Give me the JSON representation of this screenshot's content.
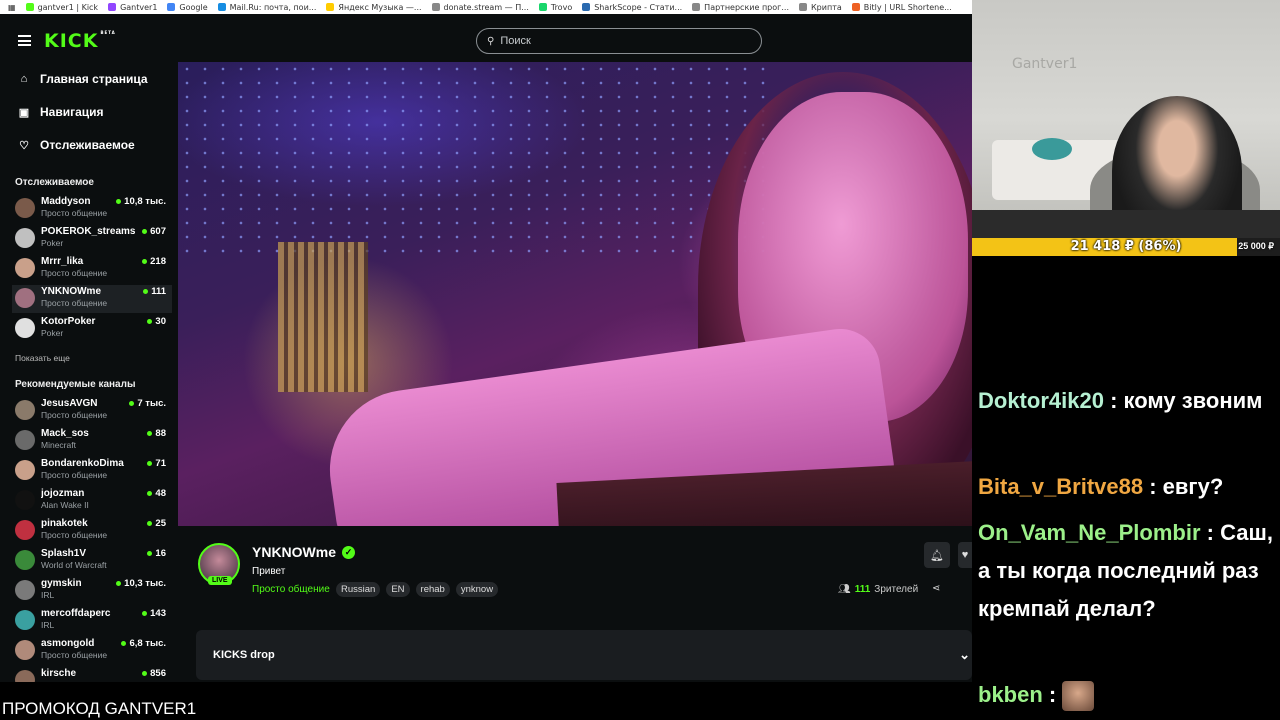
{
  "bookmarks": [
    {
      "label": "gantver1 | Kick",
      "color": "#53fc18"
    },
    {
      "label": "Gantver1",
      "color": "#9146ff"
    },
    {
      "label": "Google",
      "color": "#4285f4"
    },
    {
      "label": "Mail.Ru: почта, пои...",
      "color": "#168de2"
    },
    {
      "label": "Яндекс Музыка —...",
      "color": "#ffcc00"
    },
    {
      "label": "donate.stream — П...",
      "color": "#888888"
    },
    {
      "label": "Trovo",
      "color": "#19d66b"
    },
    {
      "label": "SharkScope - Стати...",
      "color": "#2a6ab0"
    },
    {
      "label": "Партнерские прог...",
      "color": "#888888"
    },
    {
      "label": "Крипта",
      "color": "#888888"
    },
    {
      "label": "Bitly | URL Shortene...",
      "color": "#ee6123"
    }
  ],
  "header": {
    "logo": "KICK",
    "logo_badge": "BETA",
    "search_placeholder": "Поиск"
  },
  "sidebar": {
    "nav": [
      {
        "label": "Главная страница",
        "icon": "home-icon"
      },
      {
        "label": "Навигация",
        "icon": "browse-icon"
      },
      {
        "label": "Отслеживаемое",
        "icon": "heart-icon"
      }
    ],
    "following_title": "Отслеживаемое",
    "following": [
      {
        "name": "Maddyson",
        "category": "Просто общение",
        "viewers": "10,8 тыс.",
        "color": "#7a5a4a"
      },
      {
        "name": "POKEROK_streams",
        "category": "Poker",
        "viewers": "607",
        "color": "#c0c0c0"
      },
      {
        "name": "Mrrr_lika",
        "category": "Просто общение",
        "viewers": "218",
        "color": "#c9a08a"
      },
      {
        "name": "YNKNOWme",
        "category": "Просто общение",
        "viewers": "111",
        "color": "#a07080"
      },
      {
        "name": "KotorPoker",
        "category": "Poker",
        "viewers": "30",
        "color": "#e0e0e0"
      }
    ],
    "show_more": "Показать еще",
    "recommended_title": "Рекомендуемые каналы",
    "recommended": [
      {
        "name": "JesusAVGN",
        "category": "Просто общение",
        "viewers": "7 тыс.",
        "color": "#8a7a6a"
      },
      {
        "name": "Mack_sos",
        "category": "Minecraft",
        "viewers": "88",
        "color": "#6a6a6a"
      },
      {
        "name": "BondarenkoDima",
        "category": "Просто общение",
        "viewers": "71",
        "color": "#c9a08a"
      },
      {
        "name": "jojozman",
        "category": "Alan Wake II",
        "viewers": "48",
        "color": "#111111"
      },
      {
        "name": "pinakotek",
        "category": "Просто общение",
        "viewers": "25",
        "color": "#c03040"
      },
      {
        "name": "Splash1V",
        "category": "World of Warcraft",
        "viewers": "16",
        "color": "#3a8a3a"
      },
      {
        "name": "gymskin",
        "category": "IRL",
        "viewers": "10,3 тыс.",
        "color": "#7a7a7a"
      },
      {
        "name": "mercoffdaperc",
        "category": "IRL",
        "viewers": "143",
        "color": "#3aa0a0"
      },
      {
        "name": "asmongold",
        "category": "Просто общение",
        "viewers": "6,8 тыс.",
        "color": "#b08a7a"
      },
      {
        "name": "kirsche",
        "category": "",
        "viewers": "856",
        "color": "#8a6a5a"
      }
    ]
  },
  "stream": {
    "streamer": "YNKNOWme",
    "live_label": "LIVE",
    "title": "Привет",
    "category": "Просто общение",
    "tags": [
      "Russian",
      "EN",
      "rehab",
      "ynknow"
    ],
    "viewers_count": "111",
    "viewers_label": "Зрителей",
    "drops_label": "KICKS drop"
  },
  "promo": "ПРОМОКОД GANTVER1",
  "overlay": {
    "webcam_wall_text": "Gantver1",
    "donation_amount": "21 418 ₽ (86%)",
    "donation_goal": "25 000 ₽",
    "donation_progress": 0.86
  },
  "chat": [
    {
      "user": "Doktor4ik20",
      "text": "кому звоним"
    },
    {
      "user": "Bita_v_Britve88",
      "text": "евгу?"
    },
    {
      "user": "On_Vam_Ne_Plombir",
      "text": "Саш, а ты когда последний раз кремпай делал?"
    },
    {
      "user": "bkben",
      "text": ""
    }
  ],
  "colors": {
    "accent": "#53fc18",
    "background": "#0b0e0f",
    "donation_bar": "#f3c316"
  }
}
